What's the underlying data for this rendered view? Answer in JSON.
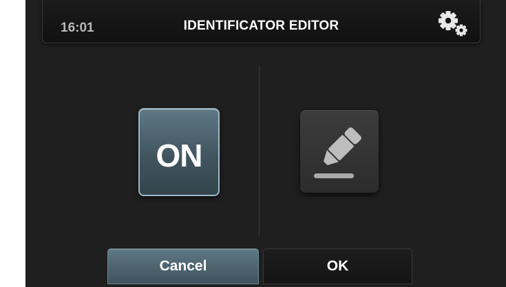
{
  "header": {
    "time": "16:01",
    "title": "IDENTIFICATOR EDITOR",
    "settings_icon": "gears-icon"
  },
  "main": {
    "toggle": {
      "label": "ON",
      "state": "on"
    },
    "edit": {
      "icon": "marker-pen-icon"
    }
  },
  "footer": {
    "cancel_label": "Cancel",
    "ok_label": "OK"
  },
  "colors": {
    "background": "#1f1f1f",
    "accent": "#4d6672",
    "accent_border": "#9bb8c6",
    "text": "#ffffff",
    "muted_text": "#b8b8b8"
  }
}
